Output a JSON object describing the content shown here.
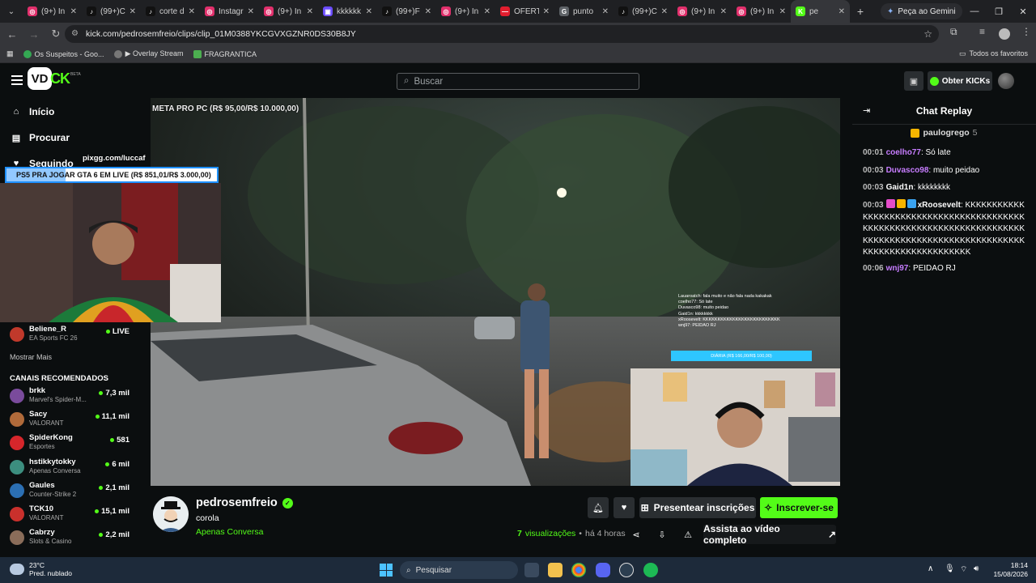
{
  "browser": {
    "tabs": [
      {
        "label": "(9+) In",
        "color": "#e1306c",
        "glyph": "◎"
      },
      {
        "label": "(99+)C",
        "color": "#111111",
        "glyph": "♪"
      },
      {
        "label": "corte d",
        "color": "#111111",
        "glyph": "♪"
      },
      {
        "label": "Instagr",
        "color": "#e1306c",
        "glyph": "◎"
      },
      {
        "label": "(9+) In",
        "color": "#e1306c",
        "glyph": "◎"
      },
      {
        "label": "kkkkkk",
        "color": "#6b4cff",
        "glyph": "▣"
      },
      {
        "label": "(99+)F",
        "color": "#111111",
        "glyph": "♪"
      },
      {
        "label": "(9+) In",
        "color": "#e1306c",
        "glyph": "◎"
      },
      {
        "label": "OFERT",
        "color": "#e11d2e",
        "glyph": "—"
      },
      {
        "label": "punto",
        "color": "#5f6368",
        "glyph": "G"
      },
      {
        "label": "(99+)C",
        "color": "#111111",
        "glyph": "♪"
      },
      {
        "label": "(9+) In",
        "color": "#e1306c",
        "glyph": "◎"
      },
      {
        "label": "(9+) In",
        "color": "#e1306c",
        "glyph": "◎"
      },
      {
        "label": "pe",
        "color": "#53fc18",
        "glyph": "K",
        "active": true
      }
    ],
    "gemini_label": "Peça ao Gemini",
    "url": "kick.com/pedrosemfreio/clips/clip_01M0388YKCGVXGZNR0DS30B8JY",
    "bookmarks": [
      "Os Suspeitos - Goo...",
      "▶ Overlay Stream",
      "FRAGRANTICA"
    ],
    "bookmarks_all": "Todos os favoritos"
  },
  "header": {
    "logo_badge": "VD",
    "logo_text": "CK",
    "logo_beta": "BETA",
    "search_placeholder": "Buscar",
    "kicks_label": "Obter KICKs"
  },
  "sidebar": {
    "nav": [
      {
        "label": "Início",
        "icon": "home-icon",
        "glyph": "⌂"
      },
      {
        "label": "Procurar",
        "icon": "browse-icon",
        "glyph": "▤"
      },
      {
        "label": "Seguindo",
        "icon": "heart-icon",
        "glyph": "♥"
      }
    ],
    "following": [
      {
        "name": "Beliene_R",
        "category": "EA Sports FC 26",
        "status": "LIVE",
        "color": "#c0392b"
      }
    ],
    "show_more": "Mostrar Mais",
    "recommended_title": "CANAIS RECOMENDADOS",
    "recommended": [
      {
        "name": "brkk",
        "category": "Marvel's Spider-M...",
        "viewers": "7,3 mil",
        "color": "#7a4b9c"
      },
      {
        "name": "Sacy",
        "category": "VALORANT",
        "viewers": "11,1 mil",
        "color": "#b06a3a"
      },
      {
        "name": "SpiderKong",
        "category": "Esportes",
        "viewers": "581",
        "color": "#d6262b"
      },
      {
        "name": "hstikkytokky",
        "category": "Apenas Conversa",
        "viewers": "6 mil",
        "color": "#3c8e7f"
      },
      {
        "name": "Gaules",
        "category": "Counter-Strike 2",
        "viewers": "2,1 mil",
        "color": "#2b6fb3"
      },
      {
        "name": "TCK10",
        "category": "VALORANT",
        "viewers": "15,1 mil",
        "color": "#c9302c"
      },
      {
        "name": "Cabrzy",
        "category": "Slots & Casino",
        "viewers": "2,2 mil",
        "color": "#8a6d5a"
      }
    ]
  },
  "stream_overlay": {
    "pix_text": "pixgg.com/luccaf",
    "goal_text": "PS5 PRA JOGAR GTA 6 EM LIVE (R$ 851,01/R$ 3.000,00)",
    "goal_fraction": 0.28
  },
  "video": {
    "caption": "META PRO PC (R$ 95,00/R$ 10.000,00)",
    "mini_chat": [
      "Lauaroatch: fala muito e não fala nada kakakak",
      "coelho77: Só late",
      "Duvasco98: muito peidao",
      "Gaid1n: kkkkkkkk",
      "xRoosevelt: KKKKKKKKKKKKKKKKKKKKKKKKKK",
      "wnj97: PEIDAO RJ"
    ],
    "mini_goal": "DIÁRIA (R$ 166,00/R$ 100,00)"
  },
  "clip": {
    "channel": "pedrosemfreio",
    "title": "corola",
    "category": "Apenas Conversa",
    "gift_label": "Presentear inscrições",
    "subscribe_label": "Inscrever-se",
    "views_count": "7",
    "views_label": "visualizações",
    "separator": "•",
    "age": "há 4 horas",
    "watch_full_label": "Assista ao vídeo completo"
  },
  "chat": {
    "title": "Chat Replay",
    "pinned_user": "paulogrego",
    "pinned_count": "5",
    "messages": [
      {
        "time": "00:01",
        "user": "coelho77",
        "color": "#c77dff",
        "text": "Só late"
      },
      {
        "time": "00:03",
        "user": "Duvasco98",
        "color": "#c77dff",
        "text": "muito peidao"
      },
      {
        "time": "00:03",
        "user": "Gaid1n",
        "color": "#ffffff",
        "text": "kkkkkkkk"
      },
      {
        "time": "00:03",
        "user": "xRoosevelt",
        "color": "#ffffff",
        "text": "KKKKKKKKKKKKKKKKKKKKKKKKKKKKKKKKKKKKKKKKKKKKKKKKKKKKKKKKKKKKKKKKKKKKKKKKKKKKKKKKKKKKKKKKKKKKKKKKKKKKKKKKKKKKKKKKKKKKKKKKK"
      },
      {
        "time": "00:06",
        "user": "wnj97",
        "color": "#c77dff",
        "text": "PEIDAO RJ"
      }
    ]
  },
  "taskbar": {
    "temp": "23°C",
    "weather": "Pred. nublado",
    "search_label": "Pesquisar",
    "time": "18:14",
    "date": "15/08/2026"
  }
}
